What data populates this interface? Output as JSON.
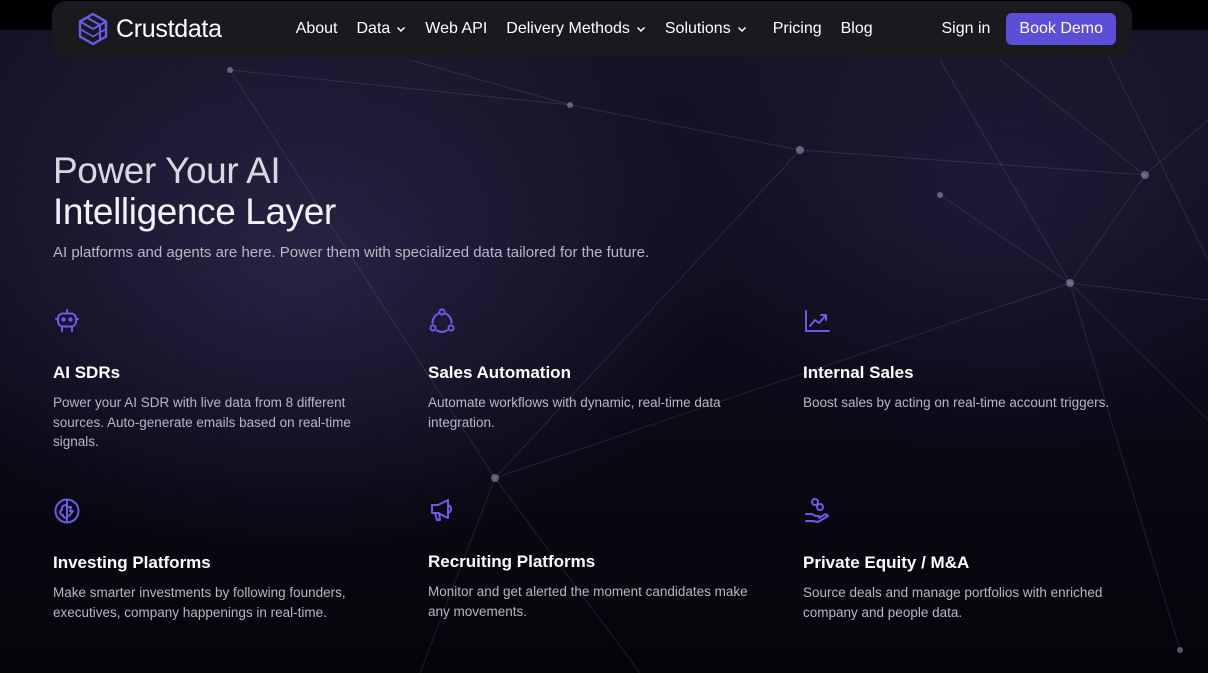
{
  "brand": {
    "name": "Crustdata",
    "logo_icon": "hexagon-cube-icon",
    "accent": "#5b4fd9"
  },
  "nav": {
    "items": [
      {
        "label": "About",
        "has_dropdown": false
      },
      {
        "label": "Data",
        "has_dropdown": true
      },
      {
        "label": "Web API",
        "has_dropdown": false
      },
      {
        "label": "Delivery Methods",
        "has_dropdown": true
      },
      {
        "label": "Solutions",
        "has_dropdown": true
      },
      {
        "label": "Pricing",
        "has_dropdown": false
      },
      {
        "label": "Blog",
        "has_dropdown": false
      }
    ],
    "signin_label": "Sign in",
    "demo_label": "Book Demo"
  },
  "hero": {
    "title_line1": "Power Your AI",
    "title_line2": "Intelligence Layer",
    "subtitle": "AI platforms and agents are here. Power them with specialized data tailored for the future."
  },
  "features": [
    {
      "icon": "robot-icon",
      "title": "AI SDRs",
      "description": "Power your AI SDR with live data from 8 different sources. Auto-generate emails based on real-time signals."
    },
    {
      "icon": "workflow-cycle-icon",
      "title": "Sales Automation",
      "description": "Automate workflows with dynamic, real-time data integration."
    },
    {
      "icon": "trend-chart-icon",
      "title": "Internal Sales",
      "description": "Boost sales by acting on real-time account triggers."
    },
    {
      "icon": "brain-icon",
      "title": "Investing Platforms",
      "description": "Make smarter investments by following founders, executives, company happenings in real-time."
    },
    {
      "icon": "megaphone-icon",
      "title": "Recruiting Platforms",
      "description": "Monitor and get alerted the moment candidates make any movements."
    },
    {
      "icon": "hand-coins-icon",
      "title": "Private Equity / M&A",
      "description": "Source deals and manage portfolios with enriched company and people data."
    }
  ]
}
